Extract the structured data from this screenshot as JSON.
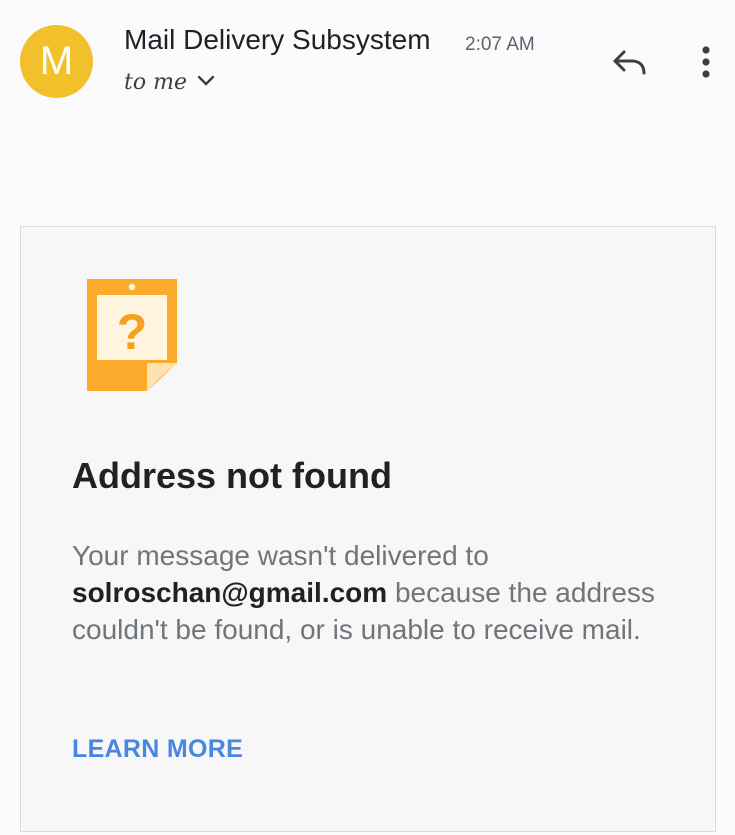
{
  "header": {
    "avatar_letter": "M",
    "sender": "Mail Delivery Subsystem",
    "time": "2:07 AM",
    "to_label": "to me"
  },
  "message": {
    "title": "Address not found",
    "body_before": "Your message wasn't delivered to",
    "email": "solroschan@gmail.com",
    "body_after": "because the address couldn't be found, or is unable to receive mail.",
    "link_label": "LEARN MORE"
  },
  "colors": {
    "avatar": "#f1c02b",
    "note_icon": "#f9a825",
    "link": "#4a86e0"
  },
  "icons": [
    "reply-icon",
    "more-vert-icon",
    "chevron-down-icon",
    "question-note-icon"
  ]
}
